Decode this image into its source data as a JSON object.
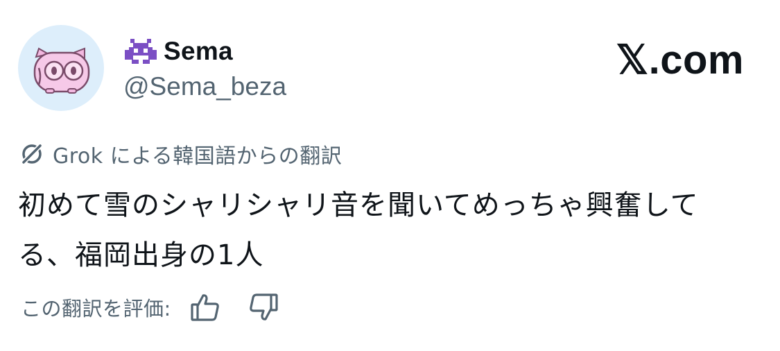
{
  "profile": {
    "display_name": "Sema",
    "handle": "@Sema_beza",
    "name_emoji": "alien-monster-icon",
    "avatar": "pink-pig-avatar"
  },
  "brand": {
    "label": "𝕏.com"
  },
  "translation": {
    "icon": "grok-icon",
    "header": "Grok による韓国語からの翻訳",
    "text": "初めて雪のシャリシャリ音を聞いてめっちゃ興奮してる、福岡出身の1人",
    "rate_label": "この翻訳を評価:",
    "thumbs_up_icon": "thumbs-up-icon",
    "thumbs_down_icon": "thumbs-down-icon"
  },
  "colors": {
    "primary_text": "#0f1419",
    "secondary_text": "#536471",
    "avatar_bg": "#ddeefb",
    "emoji_purple": "#7b4fc4",
    "pig_pink": "#f2b8e0"
  }
}
